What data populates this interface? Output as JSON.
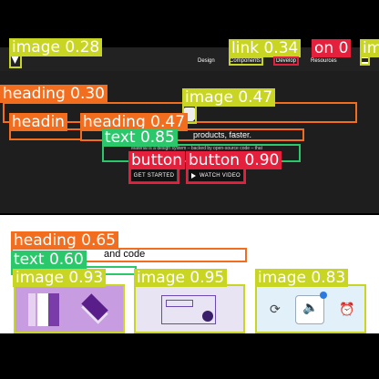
{
  "colors": {
    "lime": "#c8d623",
    "orange": "#f36d1f",
    "green": "#2ac86a",
    "red": "#e5203c",
    "page_dark": "#1e1e1e",
    "page_light": "#ffffff"
  },
  "header": {
    "logo_icon": "m-logo-icon",
    "nav": [
      "Design",
      "Components",
      "Develop",
      "Resources"
    ],
    "menu_icon": "hamburger-menu-icon"
  },
  "hero": {
    "badge_icon": "shield-badge-icon",
    "title_fragment": "products, faster.",
    "subtitle_fragment": "Material is a design system – backed by open-source code – that",
    "get_started": "GET STARTED",
    "watch_video": "WATCH VIDEO",
    "play_icon": "play-icon"
  },
  "section": {
    "text_fragment": "and code"
  },
  "cards": [
    {
      "icon": "color-layers-illustration"
    },
    {
      "icon": "components-grid-illustration"
    },
    {
      "icon": "system-icons-illustration"
    }
  ],
  "detections": [
    {
      "label": "image 0.28"
    },
    {
      "label": "link 0.34"
    },
    {
      "label": "on 0"
    },
    {
      "label": "im"
    },
    {
      "label": "heading 0.30"
    },
    {
      "label": "image 0.47"
    },
    {
      "label": "headin"
    },
    {
      "label": "heading 0.47"
    },
    {
      "label": "text 0.85"
    },
    {
      "label": "button"
    },
    {
      "label": "button 0.90"
    },
    {
      "label": "heading 0.65"
    },
    {
      "label": "text 0.60"
    },
    {
      "label": "image 0.93"
    },
    {
      "label": "image 0.95"
    },
    {
      "label": "image 0.83"
    }
  ]
}
